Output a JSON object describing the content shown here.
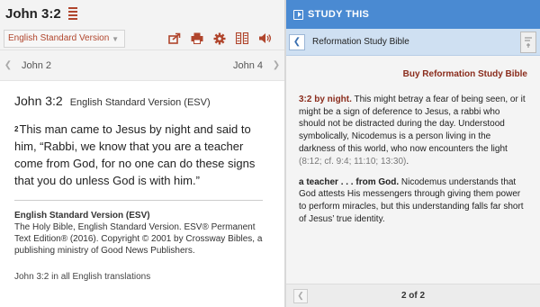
{
  "header": {
    "reference": "John 3:2"
  },
  "toolbar": {
    "version_select": "English Standard Version",
    "icons": [
      "share-icon",
      "print-icon",
      "gear-icon",
      "parallel-columns-icon",
      "audio-icon"
    ]
  },
  "chapter_nav": {
    "prev": "John 2",
    "next": "John 4"
  },
  "passage": {
    "reference": "John 3:2",
    "version": "English Standard Version (ESV)",
    "verse_number": "2",
    "text": "This man came to Jesus by night and said to him, “Rabbi, we know that you are a teacher come from God, for no one can do these signs that you do unless God is with him.”"
  },
  "copyright": {
    "title": "English Standard Version (ESV)",
    "body": "The Holy Bible, English Standard Version. ESV® Permanent Text Edition® (2016). Copyright © 2001 by Crossway Bibles, a publishing ministry of Good News Publishers."
  },
  "all_translations_link": "John 3:2 in all English translations",
  "study": {
    "header": "STUDY THIS",
    "resource_title": "Reformation Study Bible",
    "buy_link": "Buy Reformation Study Bible",
    "notes": [
      {
        "lead": "3:2 by night.",
        "text": " This might betray a fear of being seen, or it might be a sign of deference to Jesus, a rabbi who should not be distracted during the day. Understood symbolically, Nicodemus is a person living in the darkness of this world, who now encounters the light ",
        "xref": "(8:12; cf. 9:4; 11:10; 13:30)",
        "tail": "."
      },
      {
        "lead": "a teacher . . . from God.",
        "text": " Nicodemus understands that God attests His messengers through giving them power to perform miracles, but this understanding falls far short of Jesus’ true identity.",
        "xref": "",
        "tail": ""
      }
    ],
    "pager": "2 of 2"
  },
  "colors": {
    "accent": "#b0452c",
    "study_blue": "#4a8ad2",
    "resource_bar": "#cfe0f2"
  }
}
